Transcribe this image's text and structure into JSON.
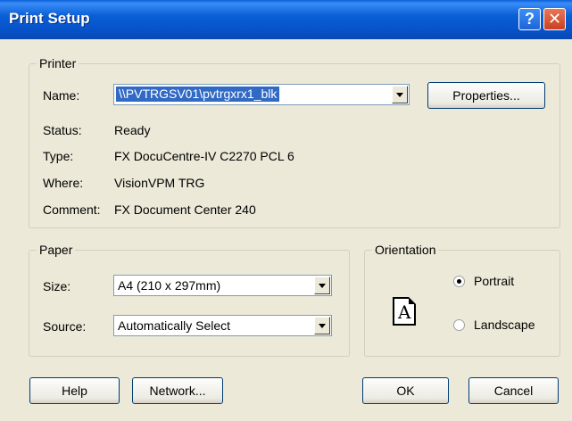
{
  "window": {
    "title": "Print Setup",
    "help_glyph": "?",
    "close_glyph": "✕"
  },
  "printer": {
    "legend": "Printer",
    "name_label": "Name:",
    "name_value": "\\\\PVTRGSV01\\pvtrgxrx1_blk",
    "properties_label": "Properties...",
    "status_label": "Status:",
    "status_value": "Ready",
    "type_label": "Type:",
    "type_value": "FX DocuCentre-IV C2270 PCL 6",
    "where_label": "Where:",
    "where_value": "VisionVPM TRG",
    "comment_label": "Comment:",
    "comment_value": "FX Document Center 240"
  },
  "paper": {
    "legend": "Paper",
    "size_label": "Size:",
    "size_value": "A4 (210 x 297mm)",
    "source_label": "Source:",
    "source_value": "Automatically Select"
  },
  "orientation": {
    "legend": "Orientation",
    "icon_letter": "A",
    "portrait_label": "Portrait",
    "landscape_label": "Landscape",
    "selected": "Portrait"
  },
  "buttons": {
    "help": "Help",
    "network": "Network...",
    "ok": "OK",
    "cancel": "Cancel"
  },
  "colors": {
    "titlebar": "#0a5fd6",
    "dialog_bg": "#ece9d8",
    "selection": "#316ac5"
  }
}
